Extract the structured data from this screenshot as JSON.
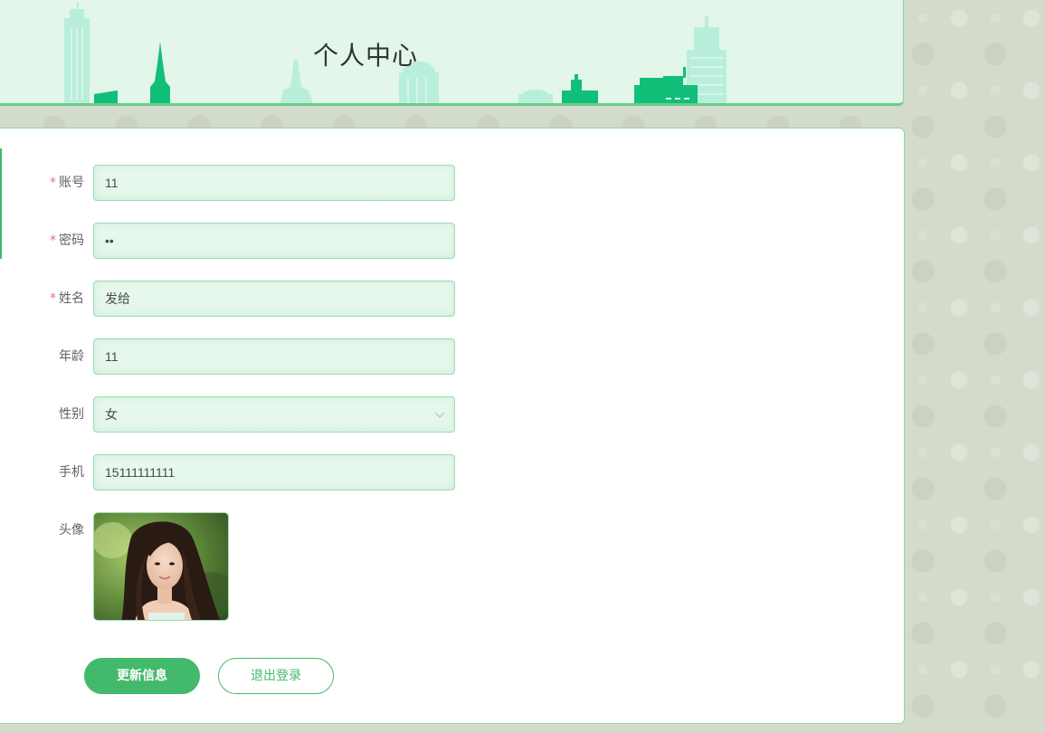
{
  "header": {
    "title": "个人中心"
  },
  "form": {
    "fields": [
      {
        "label": "账号",
        "required": true,
        "value": "11"
      },
      {
        "label": "密码",
        "required": true,
        "value": "••"
      },
      {
        "label": "姓名",
        "required": true,
        "value": "发给"
      },
      {
        "label": "年龄",
        "required": false,
        "value": "11"
      },
      {
        "label": "性别",
        "required": false,
        "value": "女"
      },
      {
        "label": "手机",
        "required": false,
        "value": "15111111111"
      }
    ],
    "avatar_label": "头像",
    "required_mark": "*"
  },
  "actions": {
    "update_label": "更新信息",
    "logout_label": "退出登录"
  },
  "colors": {
    "accent": "#43b96b",
    "banner_bg": "#e2f6ea",
    "required": "#f56c6c"
  },
  "icons": {
    "gender_select": "chevron-down-icon"
  }
}
